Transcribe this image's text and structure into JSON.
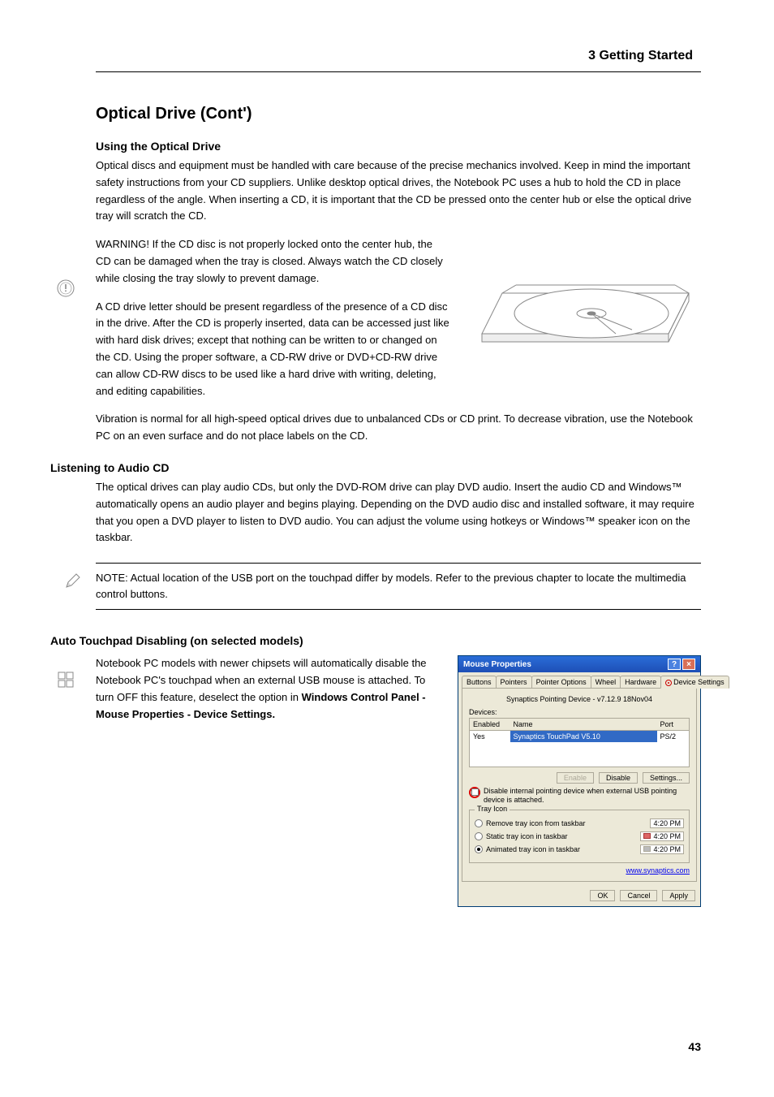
{
  "header": "3    Getting Started",
  "section_title": "Optical Drive (Cont')",
  "sub1": "Using the Optical Drive",
  "p1": "Optical discs and equipment must be handled with care because of the precise mechanics involved. Keep in mind the important safety instructions from your CD suppliers. Unlike desktop optical drives, the Notebook PC uses a hub to hold the CD in place regardless of the angle. When inserting a CD, it is important that the CD be pressed onto the center hub or else the optical drive tray will scratch the CD.",
  "warning_label": "WARNING!  If the CD disc is not properly locked onto the center hub, the CD can be damaged when the tray is closed. Always watch the CD closely while closing the tray slowly to prevent damage.",
  "p2": "A CD drive letter should be present regardless of the presence of a CD disc in the drive. After the CD is properly inserted, data can be accessed just like with hard disk drives; except that nothing can be written to or changed on the CD. Using the proper software, a CD-RW drive or DVD+CD-RW drive can allow CD-RW discs to be used like a hard drive with writing, deleting, and editing capabilities.",
  "p3": "Vibration is normal for all high-speed optical drives due to unbalanced CDs or CD print. To decrease vibration, use the Notebook PC on an even surface and do not place labels on the CD.",
  "sub2": "Listening to Audio CD",
  "p4": "The optical drives can play audio CDs, but only the DVD-ROM drive can play DVD audio. Insert the audio CD and Windows™ automatically opens an audio player and begins playing. Depending on the DVD audio disc and installed software, it may require that you open a DVD player to listen to DVD audio. You can adjust the volume using hotkeys or Windows™ speaker icon on the taskbar.",
  "note_label": "NOTE: Actual location of the USB port on the touchpad differ by models. Refer to the previous chapter to locate the multimedia control buttons.",
  "sub3": "Auto Touchpad Disabling (on selected models)",
  "p5": "Notebook PC models with newer chipsets will automatically disable the Notebook PC's touchpad when an external USB mouse is attached. To turn OFF this feature, deselect the option in ",
  "p5b": "Windows Control Panel - Mouse Properties - Device Settings.",
  "dlg": {
    "title": "Mouse Properties",
    "tabs": [
      "Buttons",
      "Pointers",
      "Pointer Options",
      "Wheel",
      "Hardware",
      "Device Settings"
    ],
    "version": "Synaptics Pointing Device - v7.12.9 18Nov04",
    "devices_label": "Devices:",
    "cols": {
      "enabled": "Enabled",
      "name": "Name",
      "port": "Port"
    },
    "row": {
      "enabled": "Yes",
      "name": "Synaptics TouchPad V5.10",
      "port": "PS/2"
    },
    "btn_enable": "Enable",
    "btn_disable": "Disable",
    "btn_settings": "Settings...",
    "cb_text": "Disable internal pointing device when external USB pointing device is attached.",
    "legend": "Tray Icon",
    "radios": [
      "Remove tray icon from taskbar",
      "Static tray icon in taskbar",
      "Animated tray icon in taskbar"
    ],
    "time": "4:20 PM",
    "link": "www.synaptics.com",
    "ok": "OK",
    "cancel": "Cancel",
    "apply": "Apply"
  },
  "page_num": "43"
}
